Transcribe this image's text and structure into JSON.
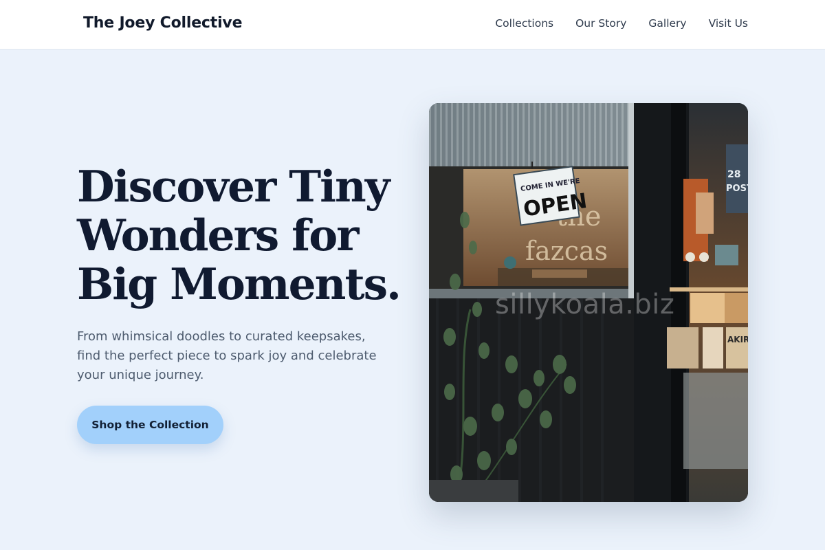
{
  "header": {
    "brand": "The Joey Collective",
    "nav": [
      {
        "label": "Collections"
      },
      {
        "label": "Our Story"
      },
      {
        "label": "Gallery"
      },
      {
        "label": "Visit Us"
      }
    ]
  },
  "hero": {
    "title_lines": [
      "Discover Tiny",
      "Wonders for",
      "Big Moments."
    ],
    "subtitle_lines": [
      "From whimsical doodles to curated keepsakes,",
      "find the perfect piece to spark joy and celebrate",
      "your unique journey."
    ],
    "cta_label": "Shop the Collection"
  },
  "photo": {
    "sign_line1": "COME IN WE'RE",
    "sign_line2": "OPEN",
    "window_text_line1": "the",
    "window_text_line2": "fazcas",
    "poster_number": "28",
    "poster_word": "POST",
    "book_word": "AKIR"
  },
  "watermark": "sillykoala.biz",
  "colors": {
    "background": "#ebf2fb",
    "cta": "#a2d0fb",
    "heading": "#101a30",
    "body_text": "#4d5b6e"
  }
}
